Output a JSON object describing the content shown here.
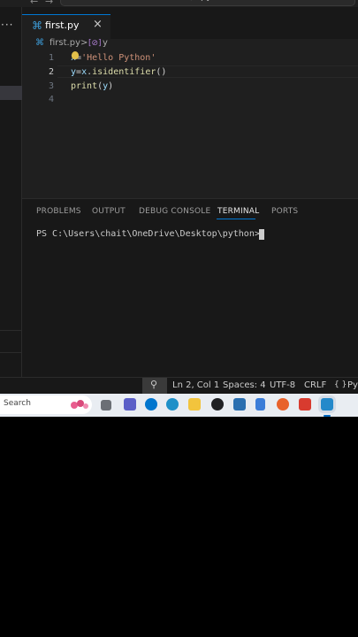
{
  "titlebar": {
    "command_center": "python"
  },
  "tabs": [
    {
      "label": "first.py",
      "close": "×"
    }
  ],
  "breadcrumb": {
    "file": "first.py",
    "separator": ">",
    "symbol_glyph": "[⊘]",
    "symbol": "y"
  },
  "editor": {
    "lines": [
      {
        "num": "1",
        "text": "x='Hello Python'"
      },
      {
        "num": "2",
        "text": "y=x.isidentifier()"
      },
      {
        "num": "3",
        "text": "print(y)"
      },
      {
        "num": "4",
        "text": ""
      }
    ],
    "tokens": {
      "l1_var": "x",
      "l1_op": "=",
      "l1_str": "'Hello Python'",
      "l2_var": "y",
      "l2_op": "=",
      "l2_obj": "x",
      "l2_dot": ".",
      "l2_fn": "isidentifier",
      "l2_paren": "()",
      "l3_fn": "print",
      "l3_open": "(",
      "l3_arg": "y",
      "l3_close": ")"
    }
  },
  "panel": {
    "tabs": [
      "PROBLEMS",
      "OUTPUT",
      "DEBUG CONSOLE",
      "TERMINAL",
      "PORTS"
    ],
    "active_tab": "TERMINAL",
    "terminal_prompt": "PS C:\\Users\\chait\\OneDrive\\Desktop\\python>"
  },
  "statusbar": {
    "position": "Ln 2, Col 1",
    "spaces": "Spaces: 4",
    "encoding": "UTF-8",
    "eol": "CRLF",
    "language_glyph": "{ }",
    "language": "Pyt"
  },
  "taskbar": {
    "search_label": "Search",
    "apps": [
      "file-explorer-small",
      "teams",
      "dell",
      "edge",
      "file-explorer",
      "chrome",
      "app-store",
      "notepad",
      "firefox",
      "office",
      "vscode"
    ]
  },
  "colors": {
    "accent": "#0078d4",
    "editor_bg": "#1f1f1f",
    "panel_bg": "#181818",
    "taskbar_bg": "#e9edf2"
  }
}
